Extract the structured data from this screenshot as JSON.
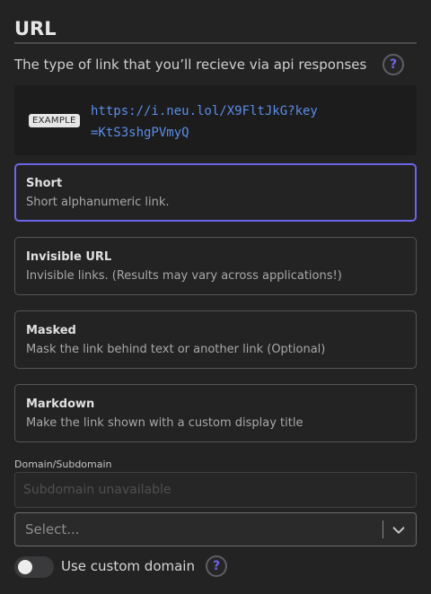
{
  "section": {
    "title": "URL",
    "description": "The type of link that you’ll recieve via api responses",
    "help_label": "?"
  },
  "example": {
    "badge": "EXAMPLE",
    "url": "https://i.neu.lol/X9FltJkG?key=KtS3shgPVmyQ"
  },
  "options": [
    {
      "title": "Short",
      "description": "Short alphanumeric link.",
      "selected": true
    },
    {
      "title": "Invisible URL",
      "description": "Invisible links. (Results may vary across applications!)",
      "selected": false
    },
    {
      "title": "Masked",
      "description": "Mask the link behind text or another link (Optional)",
      "selected": false
    },
    {
      "title": "Markdown",
      "description": "Make the link shown with a custom display title",
      "selected": false
    }
  ],
  "domain": {
    "label": "Domain/Subdomain",
    "subdomain_placeholder": "Subdomain unavailable",
    "subdomain_value": "",
    "select_placeholder": "Select..."
  },
  "custom_domain": {
    "label": "Use custom domain",
    "enabled": false,
    "help_label": "?"
  },
  "colors": {
    "accent": "#6c66e8",
    "link": "#5b8de8",
    "background": "#232323"
  }
}
